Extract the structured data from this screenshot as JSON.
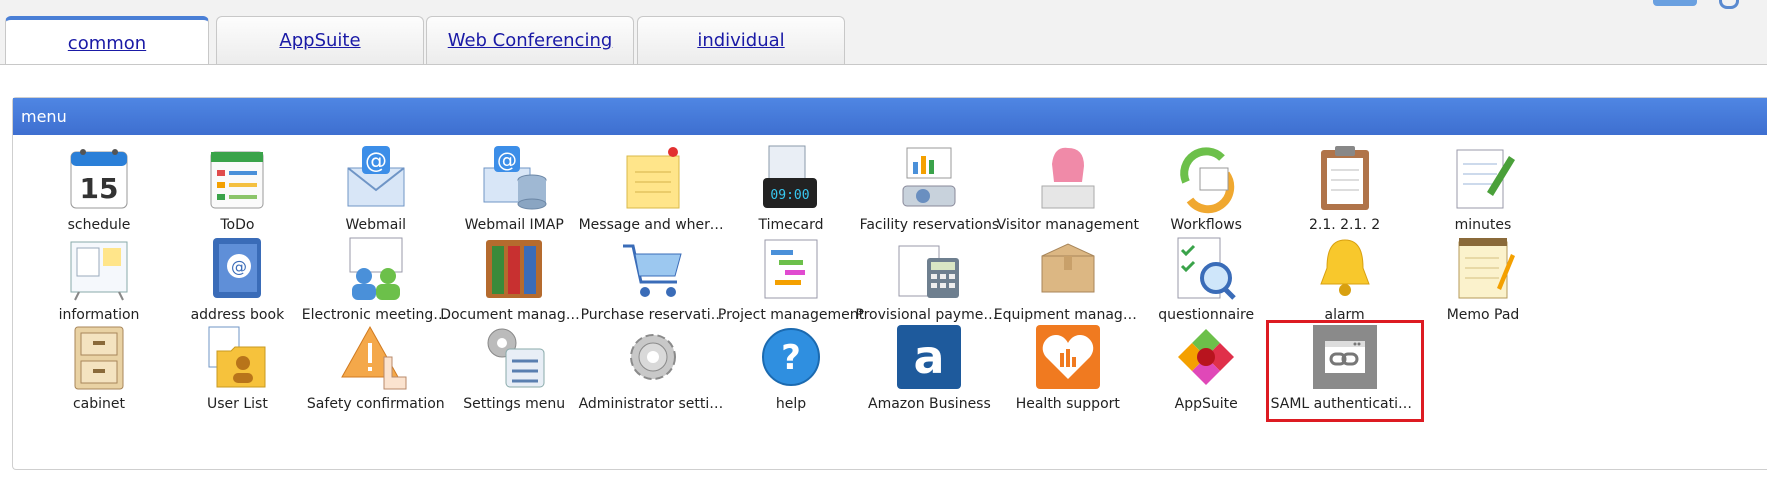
{
  "tabs": [
    {
      "label": "common",
      "active": true
    },
    {
      "label": "AppSuite",
      "active": false
    },
    {
      "label": "Web Conferencing",
      "active": false
    },
    {
      "label": "individual",
      "active": false
    }
  ],
  "menu": {
    "title": "menu",
    "rows": [
      [
        {
          "label": "schedule",
          "icon": "calendar-icon",
          "sub": "15"
        },
        {
          "label": "ToDo",
          "icon": "todo-list-icon"
        },
        {
          "label": "Webmail",
          "icon": "mail-envelope-icon",
          "sub": "@"
        },
        {
          "label": "Webmail IMAP",
          "icon": "mail-database-icon",
          "sub": "@"
        },
        {
          "label": "Message and where…",
          "icon": "sticky-note-icon"
        },
        {
          "label": "Timecard",
          "icon": "timecard-clock-icon",
          "sub": "09:00"
        },
        {
          "label": "Facility reservations",
          "icon": "projector-icon"
        },
        {
          "label": "Visitor management",
          "icon": "receptionist-icon"
        },
        {
          "label": "Workflows",
          "icon": "workflow-arrows-icon"
        },
        {
          "label": "2.1. 2.1. 2",
          "icon": "clipboard-icon"
        },
        {
          "label": "minutes",
          "icon": "notepad-pen-icon"
        }
      ],
      [
        {
          "label": "information",
          "icon": "bulletin-board-icon"
        },
        {
          "label": "address book",
          "icon": "address-book-icon",
          "sub": "@"
        },
        {
          "label": "Electronic meeting …",
          "icon": "meeting-people-icon"
        },
        {
          "label": "Document manage…",
          "icon": "binders-icon"
        },
        {
          "label": "Purchase reservati…",
          "icon": "shopping-cart-icon"
        },
        {
          "label": "Project management",
          "icon": "gantt-chart-icon"
        },
        {
          "label": "Provisional paymen…",
          "icon": "calculator-icon"
        },
        {
          "label": "Equipment manage…",
          "icon": "cardboard-box-icon"
        },
        {
          "label": "questionnaire",
          "icon": "checklist-search-icon"
        },
        {
          "label": "alarm",
          "icon": "bell-icon"
        },
        {
          "label": "Memo Pad",
          "icon": "memo-pad-icon"
        }
      ],
      [
        {
          "label": "cabinet",
          "icon": "filing-cabinet-icon"
        },
        {
          "label": "User List",
          "icon": "user-folder-icon"
        },
        {
          "label": "Safety confirmation",
          "icon": "warning-hand-icon"
        },
        {
          "label": "Settings menu",
          "icon": "settings-list-icon"
        },
        {
          "label": "Administrator settings",
          "icon": "gear-icon"
        },
        {
          "label": "help",
          "icon": "help-question-icon",
          "sub": "?"
        },
        {
          "label": "Amazon Business",
          "icon": "amazon-logo-icon",
          "sub": "a"
        },
        {
          "label": "Health support",
          "icon": "health-heart-icon"
        },
        {
          "label": "AppSuite",
          "icon": "appsuite-petals-icon"
        },
        {
          "label": "SAML authenticatio…",
          "icon": "saml-link-icon",
          "selected": true
        }
      ]
    ]
  },
  "colors": {
    "accent": "#3e6fd0",
    "highlight": "#dd1b22",
    "link": "#1a1aa6"
  }
}
